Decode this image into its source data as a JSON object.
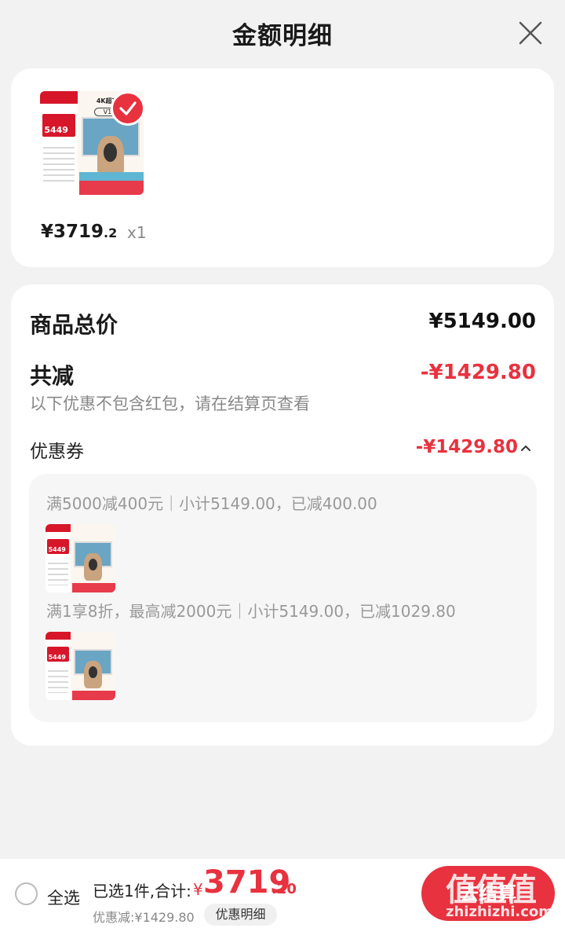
{
  "header": {
    "title": "金额明细"
  },
  "product": {
    "thumb_badge": "5449",
    "thumb_label": "V10",
    "thumb_title": "4K超高清",
    "price_int": "¥3719",
    "price_dec": ".2",
    "quantity": "x1"
  },
  "summary": {
    "total_label": "商品总价",
    "total_value": "¥5149.00",
    "reduce_label": "共减",
    "reduce_value": "-¥1429.80",
    "hint": "以下优惠不包含红包，请在结算页查看",
    "coupon_label": "优惠券",
    "coupon_value": "-¥1429.80"
  },
  "coupons": [
    {
      "condition": "满5000减400元｜小计5149.00，已减400.00"
    },
    {
      "condition": "满1享8折，最高减2000元｜小计5149.00，已减1029.80"
    }
  ],
  "bottom": {
    "select_all": "全选",
    "selected_summary": "已选1件,合计:",
    "currency": "¥",
    "total_int": "3719",
    "total_dec": ".20",
    "discount": "优惠减:¥1429.80",
    "detail_button": "优惠明细",
    "settle_button": "去结算"
  },
  "watermark": {
    "line1": "值值值",
    "line2": "zhizhizhi.com"
  },
  "colors": {
    "accent": "#e8323f",
    "background": "#f2f2f2"
  }
}
